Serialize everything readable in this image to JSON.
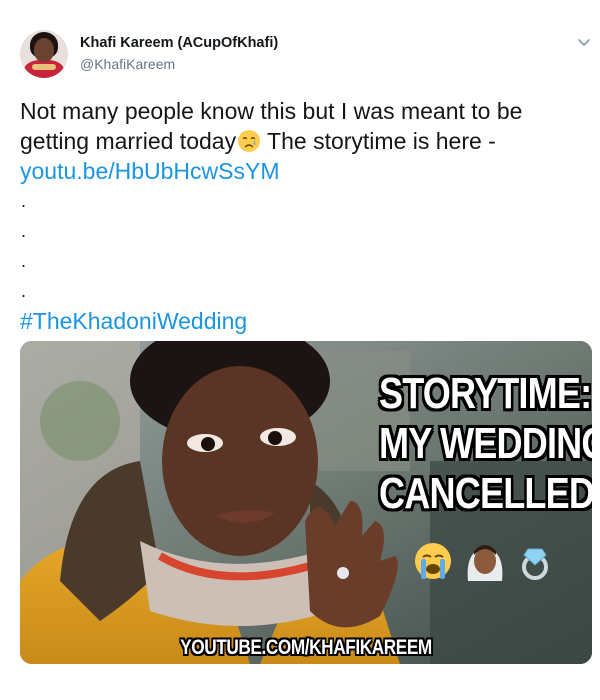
{
  "tweet": {
    "author": {
      "display_name": "Khafi Kareem (ACupOfKhafi)",
      "handle": "@KhafiKareem",
      "avatar_icon": "profile-photo"
    },
    "menu_icon": "chevron-down-icon",
    "text": {
      "line1": "Not many people know this but I was meant to be",
      "line2_before_emoji": "getting married today",
      "line2_emoji": "crying-face-emoji",
      "line2_after_emoji": " The storytime is here -",
      "link": "youtu.be/HbUbHcwSsYM",
      "dots": [
        ".",
        ".",
        ".",
        "."
      ],
      "hashtag": "#TheKhadoniWedding"
    },
    "media": {
      "title_lines": [
        "STORYTIME:",
        "MY WEDDING",
        "CANCELLED?!"
      ],
      "emojis": [
        "loudly-crying-face-emoji",
        "bride-with-veil-emoji",
        "ring-emoji"
      ],
      "footer": "YOUTUBE.COM/KHAFIKAREEM"
    },
    "colors": {
      "link": "#1b95e0",
      "secondary_text": "#657786",
      "primary_text": "#14171a"
    }
  }
}
